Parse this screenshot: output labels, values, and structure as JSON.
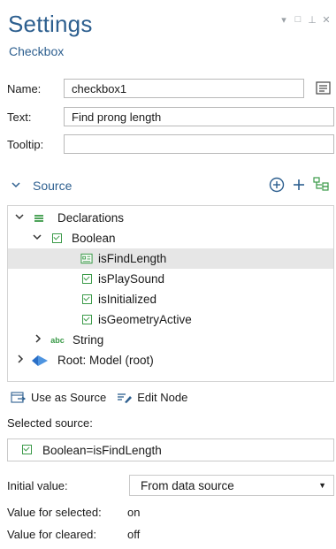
{
  "header": {
    "title": "Settings",
    "subtitle": "Checkbox"
  },
  "form": {
    "name_label": "Name:",
    "name_value": "checkbox1",
    "text_label": "Text:",
    "text_value": "Find prong length",
    "tooltip_label": "Tooltip:",
    "tooltip_value": ""
  },
  "source": {
    "title": "Source",
    "tree": [
      {
        "label": "Declarations",
        "level": 0,
        "expanded": true,
        "icon": "declarations-icon"
      },
      {
        "label": "Boolean",
        "level": 1,
        "expanded": true,
        "icon": "boolean-icon"
      },
      {
        "label": "isFindLength",
        "level": 2,
        "selected": true,
        "icon": "boolean-variable-icon"
      },
      {
        "label": "isPlaySound",
        "level": 2,
        "icon": "checkbox-icon"
      },
      {
        "label": "isInitialized",
        "level": 2,
        "icon": "checkbox-icon"
      },
      {
        "label": "isGeometryActive",
        "level": 2,
        "icon": "checkbox-icon"
      },
      {
        "label": "String",
        "level": 1,
        "expanded": false,
        "icon": "abc-icon"
      },
      {
        "label": "Root: Model (root)",
        "level": 0,
        "expanded": false,
        "icon": "model-icon"
      }
    ]
  },
  "actions": {
    "use_as_source": "Use as Source",
    "edit_node": "Edit Node"
  },
  "selected_source": {
    "label": "Selected source:",
    "value": "Boolean=isFindLength"
  },
  "initial_value": {
    "label": "Initial value:",
    "value": "From data source"
  },
  "value_selected": {
    "label": "Value for selected:",
    "value": "on"
  },
  "value_cleared": {
    "label": "Value for cleared:",
    "value": "off"
  },
  "colors": {
    "accent": "#2d5f8f",
    "check_green": "#3a9a48",
    "selected_row": "#e6e6e6"
  }
}
